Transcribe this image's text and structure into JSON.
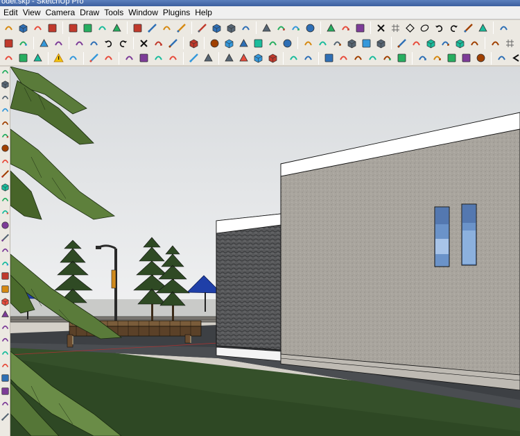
{
  "window": {
    "title": "odel.skp - SketchUp Pro"
  },
  "menu": [
    {
      "label": "Edit",
      "key": "edit"
    },
    {
      "label": "View",
      "key": "view"
    },
    {
      "label": "Camera",
      "key": "camera"
    },
    {
      "label": "Draw",
      "key": "draw"
    },
    {
      "label": "Tools",
      "key": "tools"
    },
    {
      "label": "Window",
      "key": "window"
    },
    {
      "label": "Plugins",
      "key": "plugins"
    },
    {
      "label": "Help",
      "key": "help"
    }
  ],
  "colors": {
    "sky": "#e8eaec",
    "grass": "#35502a",
    "pavement": "#3d4044",
    "wall_stucco": "#a9a59e",
    "wall_stone": "#57585a",
    "trim": "#ffffff",
    "umbrella": "#1f3fa8",
    "palm_leaf": "#5a7b3a",
    "glass": "#6b93c9"
  },
  "toolbars": {
    "row1": [
      "line-icon",
      "rectangle-icon",
      "circle-icon",
      "arc-icon",
      "sep",
      "eraser-icon",
      "paint-bucket-icon",
      "make-component-icon",
      "move-icon",
      "sep",
      "push-pull-icon",
      "rotate-icon",
      "follow-me-icon",
      "scale-icon",
      "sep",
      "orbit-icon",
      "pan-icon",
      "zoom-icon",
      "zoom-extents-icon",
      "sep",
      "previous-view-icon",
      "next-view-icon",
      "position-camera-icon",
      "walk-icon",
      "sep",
      "look-around-icon",
      "section-plane-icon",
      "display-section-icon",
      "sep",
      "close-x-icon",
      "grid-icon",
      "diamond-icon",
      "loop-icon",
      "undo-icon",
      "redo-icon",
      "plugin-a-icon",
      "plugin-b-icon",
      "sep",
      "axes-icon"
    ],
    "row2": [
      "paint-icon",
      "save-icon",
      "sep",
      "tape-measure-icon",
      "dimension-icon",
      "sep",
      "protractor-icon",
      "text-icon",
      "undo-icon",
      "redo-icon",
      "sep",
      "delete-icon",
      "photo-icon",
      "print-icon",
      "sep",
      "model-info-icon",
      "sep",
      "iso-view-icon",
      "top-view-icon",
      "front-view-icon",
      "right-view-icon",
      "back-view-icon",
      "left-view-icon",
      "sep",
      "xray-icon",
      "wireframe-icon",
      "hidden-line-icon",
      "shaded-icon",
      "textured-icon",
      "monochrome-icon",
      "sep",
      "solid-union-icon",
      "solid-subtract-icon",
      "solid-trim-icon",
      "solid-intersect-icon",
      "solid-split-icon",
      "solid-outer-icon",
      "sep",
      "layer-icon",
      "grid-icon"
    ],
    "row3": [
      "eraser-small-icon",
      "freehand-icon",
      "arc-small-icon",
      "sep",
      "warning-icon",
      "flower-icon",
      "sep",
      "axis-icon",
      "text3d-icon",
      "sep",
      "shadow-icon",
      "fog-icon",
      "sun-icon",
      "flag-icon",
      "sep",
      "sandbox-icon",
      "component-icon",
      "sep",
      "texture-a-icon",
      "texture-b-icon",
      "texture-c-icon",
      "texture-d-icon",
      "sep",
      "tree-icon",
      "person-icon",
      "sep",
      "curve-icon",
      "smooth-icon",
      "stamp-icon",
      "drape-icon",
      "add-detail-icon",
      "flip-edge-icon",
      "sep",
      "material-a-icon",
      "material-b-icon",
      "material-c-icon",
      "material-d-icon",
      "material-e-icon",
      "sep",
      "pencil-icon",
      "left-arrow-icon",
      "right-arrow-icon"
    ]
  },
  "left_tools": [
    "select-icon",
    "eraser-icon",
    "line-icon",
    "arc-icon",
    "paint-icon",
    "push-pull-icon",
    "follow-me-icon",
    "rotate-icon",
    "scale-icon",
    "offset-icon",
    "tape-icon",
    "text-icon",
    "axes-icon",
    "orbit-icon",
    "pan-icon",
    "zoom-icon",
    "walk-icon",
    "look-icon",
    "section-icon",
    "component-icon",
    "layer-icon",
    "model-icon",
    "cube-icon",
    "box-icon",
    "window-icon",
    "bottom-icon",
    "end-icon",
    "last-icon"
  ],
  "viewport": {
    "name": "3d-model-viewport",
    "scene_objects": [
      "stucco-building",
      "stone-wall-building",
      "window-left",
      "window-right",
      "pine-tree-1",
      "pine-tree-2",
      "pine-tree-3",
      "street-lamp",
      "blue-umbrella-left",
      "blue-umbrella-right",
      "bench",
      "palm-leaves",
      "lawn",
      "walkway",
      "low-fence"
    ]
  }
}
